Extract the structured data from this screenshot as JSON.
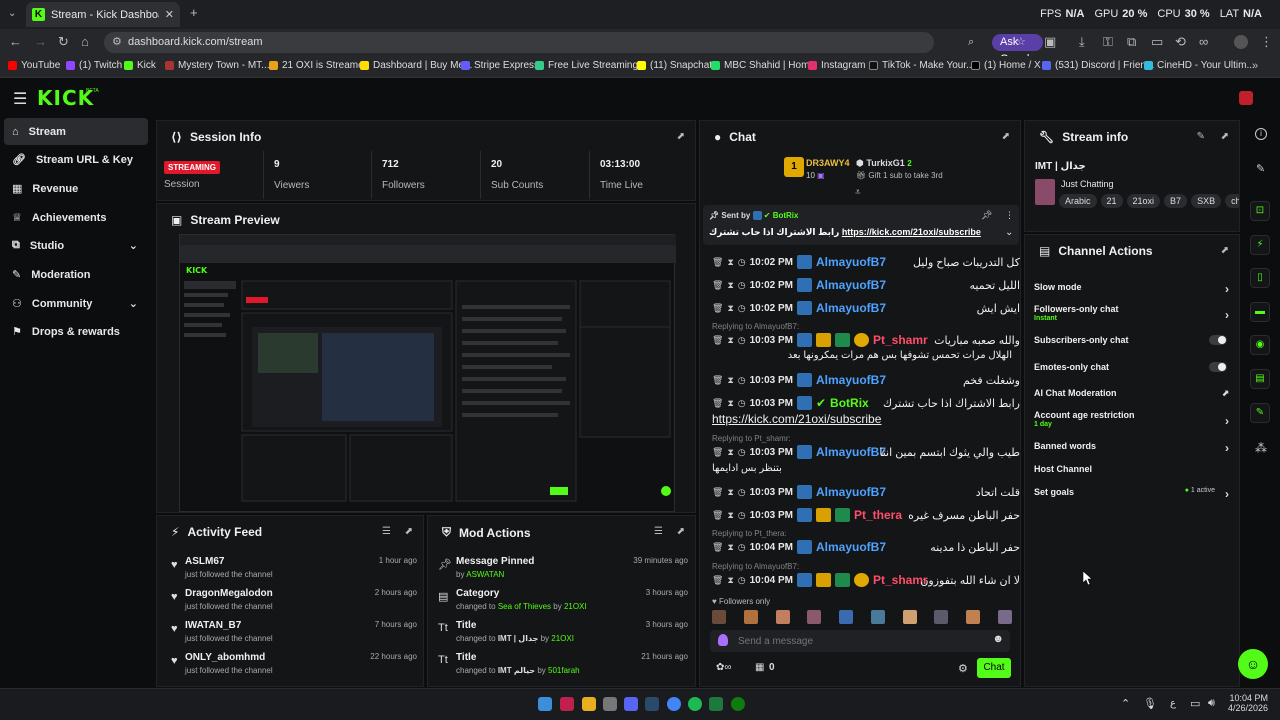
{
  "browser": {
    "tab_title": "Stream - Kick Dashboard",
    "url": "dashboard.kick.com/stream",
    "ask_google": "Ask Google",
    "perf": {
      "fps_label": "FPS",
      "fps": "N/A",
      "gpu_label": "GPU",
      "gpu": "20 %",
      "cpu_label": "CPU",
      "cpu": "30 %",
      "lat_label": "LAT",
      "lat": "N/A"
    },
    "bookmarks": [
      "YouTube",
      "(1) Twitch",
      "Kick",
      "Mystery Town - MT...",
      "21 OXI is Streamer",
      "Dashboard | Buy Me...",
      "Stripe Express",
      "Free Live Streaming...",
      "(11) Snapchat",
      "MBC Shahid | Home",
      "Instagram",
      "TikTok - Make Your...",
      "(1) Home / X",
      "(531) Discord | Frien...",
      "CineHD - Your Ultim..."
    ]
  },
  "app": {
    "logo": "KICK",
    "logo_tag": "BETA"
  },
  "sidebar": {
    "items": [
      {
        "label": "Stream"
      },
      {
        "label": "Stream URL & Key"
      },
      {
        "label": "Revenue"
      },
      {
        "label": "Achievements"
      },
      {
        "label": "Studio"
      },
      {
        "label": "Moderation"
      },
      {
        "label": "Community"
      },
      {
        "label": "Drops & rewards"
      }
    ]
  },
  "session": {
    "title": "Session Info",
    "status_badge": "STREAMING",
    "status_label": "Session",
    "stats": [
      {
        "value": "9",
        "label": "Viewers"
      },
      {
        "value": "712",
        "label": "Followers"
      },
      {
        "value": "20",
        "label": "Sub Counts"
      },
      {
        "value": "03:13:00",
        "label": "Time Live"
      }
    ]
  },
  "preview": {
    "title": "Stream Preview"
  },
  "activity": {
    "title": "Activity Feed",
    "items": [
      {
        "name": "ASLM67",
        "sub": "just followed the channel",
        "time": "1 hour ago"
      },
      {
        "name": "DragonMegalodon",
        "sub": "just followed the channel",
        "time": "2 hours ago"
      },
      {
        "name": "IWATAN_B7",
        "sub": "just followed the channel",
        "time": "7 hours ago"
      },
      {
        "name": "ONLY_abomhmd",
        "sub": "just followed the channel",
        "time": "22 hours ago"
      }
    ]
  },
  "mod_actions": {
    "title": "Mod Actions",
    "items": [
      {
        "title": "Message Pinned",
        "pre": "by ",
        "value": "ASWATAN",
        "mid": "",
        "by": "",
        "time": "39 minutes ago"
      },
      {
        "title": "Category",
        "pre": "changed to ",
        "value": "Sea of Thieves",
        "mid": " by ",
        "by": "21OXI",
        "time": "3 hours ago"
      },
      {
        "title": "Title",
        "pre": "changed to ",
        "value": "IMT | جدال",
        "mid": " by ",
        "by": "21OXI",
        "time": "3 hours ago"
      },
      {
        "title": "Title",
        "pre": "changed to ",
        "value": "IMT حيالم",
        "mid": " by ",
        "by": "501farah",
        "time": "21 hours ago"
      }
    ]
  },
  "chat": {
    "title": "Chat",
    "gifter1": {
      "name": "DR3AWY4",
      "count": "10",
      "rank": "1"
    },
    "gifter2": {
      "name": "TurkixG1",
      "count": "2",
      "note": "Gift 1 sub to take 3rd"
    },
    "pinned": {
      "sent_by": "Sent by",
      "user": "BotRix",
      "text": "رابط الاشتراك اذا حاب تشترك",
      "link": "https://kick.com/21oxi/subscribe"
    },
    "messages": [
      {
        "time": "10:02 PM",
        "user": "AlmayuofB7",
        "text": "كل التدريبات صباح وليل",
        "reply": ""
      },
      {
        "time": "10:02 PM",
        "user": "AlmayuofB7",
        "text": "الليل تحميه",
        "reply": ""
      },
      {
        "time": "10:02 PM",
        "user": "AlmayuofB7",
        "text": "ايش ايش",
        "reply": ""
      },
      {
        "time": "10:03 PM",
        "user": "Pt_shamr",
        "text": "والله صعبه مباريات",
        "text2": "الهلال مرات تحمس تشوفها بس هم مرات يمكرونها بعد",
        "reply": "Replying to AlmayuofB7:"
      },
      {
        "time": "10:03 PM",
        "user": "AlmayuofB7",
        "text": "وشغلت فخم",
        "reply": ""
      },
      {
        "time": "10:03 PM",
        "user": "BotRix",
        "text": "رابط الاشتراك اذا حاب تشترك",
        "link": "https://kick.com/21oxi/subscribe",
        "reply": ""
      },
      {
        "time": "10:03 PM",
        "user": "AlmayuofB7",
        "text": "طيب والي يثوك ابتسم بمين انتا",
        "text2": "بتنظر بس ادايمها",
        "reply": "Replying to Pt_shamr:"
      },
      {
        "time": "10:03 PM",
        "user": "AlmayuofB7",
        "text": "قلت اتحاد",
        "reply": ""
      },
      {
        "time": "10:03 PM",
        "user": "Pt_thera",
        "text": "حفر الباطن مسرف غيره",
        "reply": ""
      },
      {
        "time": "10:04 PM",
        "user": "AlmayuofB7",
        "text": "حفر الباطن ذا مدينه",
        "reply": "Replying to Pt_thera:"
      },
      {
        "time": "10:04 PM",
        "user": "Pt_shamr",
        "text": "لا ان شاء الله بتفوزون",
        "reply": "Replying to AlmayuofB7:"
      }
    ],
    "followers_only": "Followers only",
    "input_placeholder": "Send a message",
    "points": "0",
    "send": "Chat"
  },
  "stream_info": {
    "title": "Stream info",
    "stream_title": "IMT | جدال",
    "category": "Just Chatting",
    "tags": [
      "Arabic",
      "21",
      "21oxi",
      "B7",
      "SXB",
      "chi"
    ]
  },
  "channel_actions": {
    "title": "Channel Actions",
    "items": [
      {
        "label": "Slow mode",
        "sub": "",
        "ctrl": "chevron"
      },
      {
        "label": "Followers-only chat",
        "sub": "Instant",
        "ctrl": "chevron"
      },
      {
        "label": "Subscribers-only chat",
        "sub": "",
        "ctrl": "toggle"
      },
      {
        "label": "Emotes-only chat",
        "sub": "",
        "ctrl": "toggle"
      },
      {
        "label": "AI Chat Moderation",
        "sub": "",
        "ctrl": "external"
      },
      {
        "label": "Account age restriction",
        "sub": "1 day",
        "ctrl": "chevron"
      },
      {
        "label": "Banned words",
        "sub": "",
        "ctrl": "chevron"
      },
      {
        "label": "Host Channel",
        "sub": "",
        "ctrl": "none"
      },
      {
        "label": "Set goals",
        "sub": "",
        "ctrl": "chevron",
        "status": "1 active"
      }
    ]
  },
  "taskbar": {
    "time": "10:04 PM",
    "date": "4/26/2026",
    "lang": "ع"
  },
  "colors": {
    "accent": "#53fc18",
    "bg": "#0b0d0f",
    "panel": "#141517",
    "streaming": "#e0182c",
    "user_blue": "#4ea3ff",
    "user_pink": "#ff4d6a"
  }
}
